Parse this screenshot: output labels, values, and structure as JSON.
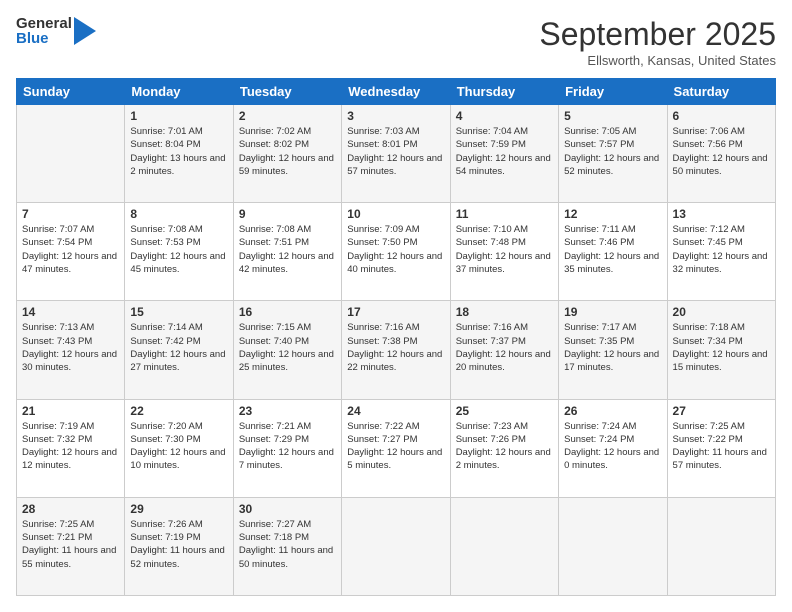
{
  "header": {
    "logo_line1": "General",
    "logo_line2": "Blue",
    "month": "September 2025",
    "location": "Ellsworth, Kansas, United States"
  },
  "days_of_week": [
    "Sunday",
    "Monday",
    "Tuesday",
    "Wednesday",
    "Thursday",
    "Friday",
    "Saturday"
  ],
  "weeks": [
    [
      {
        "num": "",
        "sunrise": "",
        "sunset": "",
        "daylight": ""
      },
      {
        "num": "1",
        "sunrise": "Sunrise: 7:01 AM",
        "sunset": "Sunset: 8:04 PM",
        "daylight": "Daylight: 13 hours and 2 minutes."
      },
      {
        "num": "2",
        "sunrise": "Sunrise: 7:02 AM",
        "sunset": "Sunset: 8:02 PM",
        "daylight": "Daylight: 12 hours and 59 minutes."
      },
      {
        "num": "3",
        "sunrise": "Sunrise: 7:03 AM",
        "sunset": "Sunset: 8:01 PM",
        "daylight": "Daylight: 12 hours and 57 minutes."
      },
      {
        "num": "4",
        "sunrise": "Sunrise: 7:04 AM",
        "sunset": "Sunset: 7:59 PM",
        "daylight": "Daylight: 12 hours and 54 minutes."
      },
      {
        "num": "5",
        "sunrise": "Sunrise: 7:05 AM",
        "sunset": "Sunset: 7:57 PM",
        "daylight": "Daylight: 12 hours and 52 minutes."
      },
      {
        "num": "6",
        "sunrise": "Sunrise: 7:06 AM",
        "sunset": "Sunset: 7:56 PM",
        "daylight": "Daylight: 12 hours and 50 minutes."
      }
    ],
    [
      {
        "num": "7",
        "sunrise": "Sunrise: 7:07 AM",
        "sunset": "Sunset: 7:54 PM",
        "daylight": "Daylight: 12 hours and 47 minutes."
      },
      {
        "num": "8",
        "sunrise": "Sunrise: 7:08 AM",
        "sunset": "Sunset: 7:53 PM",
        "daylight": "Daylight: 12 hours and 45 minutes."
      },
      {
        "num": "9",
        "sunrise": "Sunrise: 7:08 AM",
        "sunset": "Sunset: 7:51 PM",
        "daylight": "Daylight: 12 hours and 42 minutes."
      },
      {
        "num": "10",
        "sunrise": "Sunrise: 7:09 AM",
        "sunset": "Sunset: 7:50 PM",
        "daylight": "Daylight: 12 hours and 40 minutes."
      },
      {
        "num": "11",
        "sunrise": "Sunrise: 7:10 AM",
        "sunset": "Sunset: 7:48 PM",
        "daylight": "Daylight: 12 hours and 37 minutes."
      },
      {
        "num": "12",
        "sunrise": "Sunrise: 7:11 AM",
        "sunset": "Sunset: 7:46 PM",
        "daylight": "Daylight: 12 hours and 35 minutes."
      },
      {
        "num": "13",
        "sunrise": "Sunrise: 7:12 AM",
        "sunset": "Sunset: 7:45 PM",
        "daylight": "Daylight: 12 hours and 32 minutes."
      }
    ],
    [
      {
        "num": "14",
        "sunrise": "Sunrise: 7:13 AM",
        "sunset": "Sunset: 7:43 PM",
        "daylight": "Daylight: 12 hours and 30 minutes."
      },
      {
        "num": "15",
        "sunrise": "Sunrise: 7:14 AM",
        "sunset": "Sunset: 7:42 PM",
        "daylight": "Daylight: 12 hours and 27 minutes."
      },
      {
        "num": "16",
        "sunrise": "Sunrise: 7:15 AM",
        "sunset": "Sunset: 7:40 PM",
        "daylight": "Daylight: 12 hours and 25 minutes."
      },
      {
        "num": "17",
        "sunrise": "Sunrise: 7:16 AM",
        "sunset": "Sunset: 7:38 PM",
        "daylight": "Daylight: 12 hours and 22 minutes."
      },
      {
        "num": "18",
        "sunrise": "Sunrise: 7:16 AM",
        "sunset": "Sunset: 7:37 PM",
        "daylight": "Daylight: 12 hours and 20 minutes."
      },
      {
        "num": "19",
        "sunrise": "Sunrise: 7:17 AM",
        "sunset": "Sunset: 7:35 PM",
        "daylight": "Daylight: 12 hours and 17 minutes."
      },
      {
        "num": "20",
        "sunrise": "Sunrise: 7:18 AM",
        "sunset": "Sunset: 7:34 PM",
        "daylight": "Daylight: 12 hours and 15 minutes."
      }
    ],
    [
      {
        "num": "21",
        "sunrise": "Sunrise: 7:19 AM",
        "sunset": "Sunset: 7:32 PM",
        "daylight": "Daylight: 12 hours and 12 minutes."
      },
      {
        "num": "22",
        "sunrise": "Sunrise: 7:20 AM",
        "sunset": "Sunset: 7:30 PM",
        "daylight": "Daylight: 12 hours and 10 minutes."
      },
      {
        "num": "23",
        "sunrise": "Sunrise: 7:21 AM",
        "sunset": "Sunset: 7:29 PM",
        "daylight": "Daylight: 12 hours and 7 minutes."
      },
      {
        "num": "24",
        "sunrise": "Sunrise: 7:22 AM",
        "sunset": "Sunset: 7:27 PM",
        "daylight": "Daylight: 12 hours and 5 minutes."
      },
      {
        "num": "25",
        "sunrise": "Sunrise: 7:23 AM",
        "sunset": "Sunset: 7:26 PM",
        "daylight": "Daylight: 12 hours and 2 minutes."
      },
      {
        "num": "26",
        "sunrise": "Sunrise: 7:24 AM",
        "sunset": "Sunset: 7:24 PM",
        "daylight": "Daylight: 12 hours and 0 minutes."
      },
      {
        "num": "27",
        "sunrise": "Sunrise: 7:25 AM",
        "sunset": "Sunset: 7:22 PM",
        "daylight": "Daylight: 11 hours and 57 minutes."
      }
    ],
    [
      {
        "num": "28",
        "sunrise": "Sunrise: 7:25 AM",
        "sunset": "Sunset: 7:21 PM",
        "daylight": "Daylight: 11 hours and 55 minutes."
      },
      {
        "num": "29",
        "sunrise": "Sunrise: 7:26 AM",
        "sunset": "Sunset: 7:19 PM",
        "daylight": "Daylight: 11 hours and 52 minutes."
      },
      {
        "num": "30",
        "sunrise": "Sunrise: 7:27 AM",
        "sunset": "Sunset: 7:18 PM",
        "daylight": "Daylight: 11 hours and 50 minutes."
      },
      {
        "num": "",
        "sunrise": "",
        "sunset": "",
        "daylight": ""
      },
      {
        "num": "",
        "sunrise": "",
        "sunset": "",
        "daylight": ""
      },
      {
        "num": "",
        "sunrise": "",
        "sunset": "",
        "daylight": ""
      },
      {
        "num": "",
        "sunrise": "",
        "sunset": "",
        "daylight": ""
      }
    ]
  ]
}
